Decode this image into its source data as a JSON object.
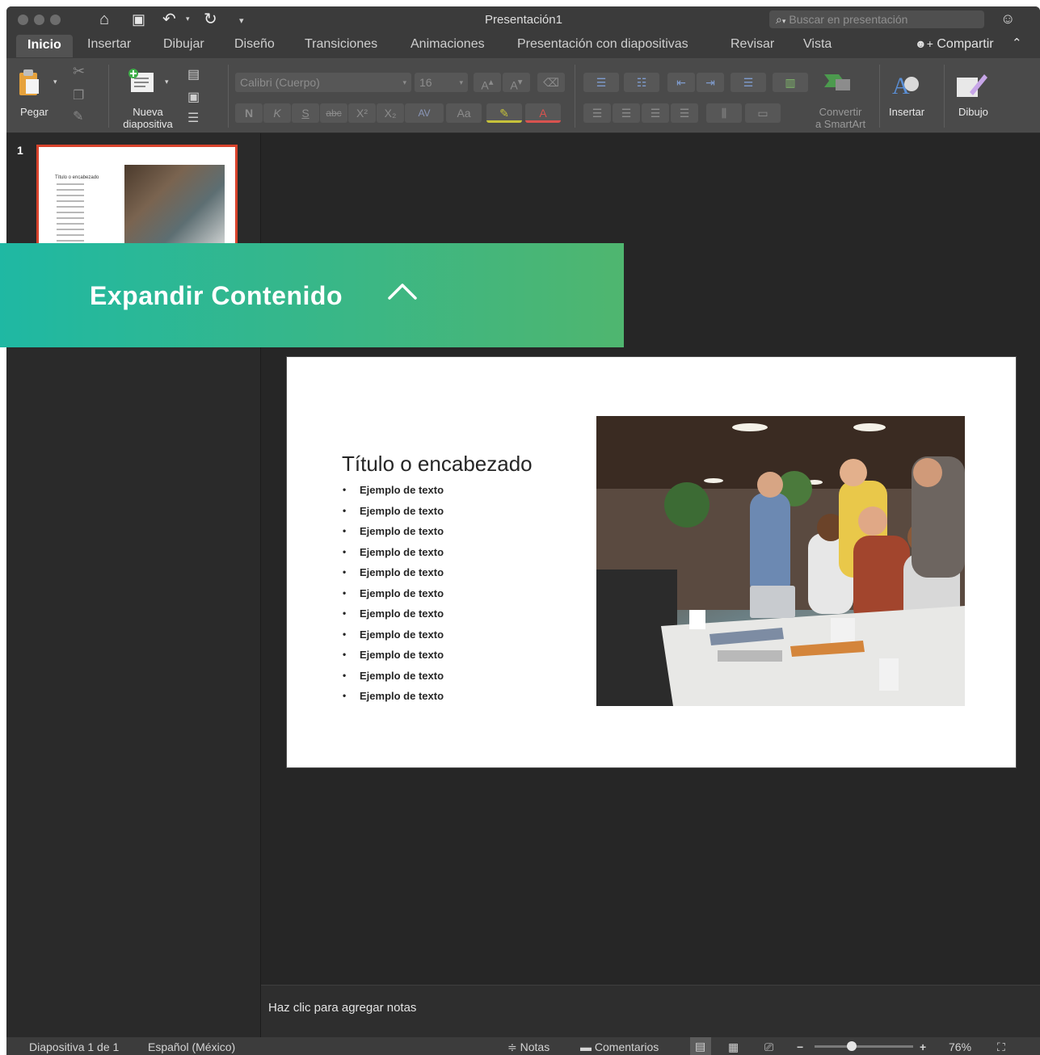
{
  "window": {
    "title": "Presentación1",
    "search_placeholder": "Buscar en presentación",
    "search_icon": "⌕",
    "account_icon": "☺"
  },
  "quick_access": {
    "home_icon": "⌂",
    "save_icon": "▣",
    "undo_icon": "↶",
    "redo_icon": "↻",
    "customize_icon": "▾"
  },
  "tabs": [
    "Inicio",
    "Insertar",
    "Dibujar",
    "Diseño",
    "Transiciones",
    "Animaciones",
    "Presentación con diapositivas",
    "Revisar",
    "Vista"
  ],
  "share": {
    "label": "Compartir",
    "icon": "☺"
  },
  "ribbon": {
    "paste_label": "Pegar",
    "new_slide_label_1": "Nueva",
    "new_slide_label_2": "diapositiva",
    "font_family": "Calibri (Cuerpo)",
    "font_size": "16",
    "grow_font": "A",
    "shrink_font": "A",
    "bold": "N",
    "italic": "K",
    "underline": "S",
    "strike": "abc",
    "superscript": "X²",
    "subscript": "X₂",
    "spacing": "AV",
    "case": "Aa",
    "highlight": "✎",
    "font_color": "A",
    "convert_label_1": "Convertir",
    "convert_label_2": "a SmartArt",
    "insert_label": "Insertar",
    "draw_label": "Dibujo"
  },
  "thumbnails": {
    "slide_number": "1",
    "mini_title": "Título o encabezado"
  },
  "slide": {
    "title": "Título o encabezado",
    "bullets": [
      "Ejemplo de texto",
      "Ejemplo de texto",
      "Ejemplo de texto",
      "Ejemplo de texto",
      "Ejemplo de texto",
      "Ejemplo de texto",
      "Ejemplo de texto",
      "Ejemplo de texto",
      "Ejemplo de texto",
      "Ejemplo de texto",
      "Ejemplo de texto"
    ]
  },
  "notes": {
    "placeholder": "Haz clic para agregar notas"
  },
  "status": {
    "slide_info": "Diapositiva 1 de 1",
    "language": "Español (México)",
    "notes_label": "Notas",
    "comments_label": "Comentarios",
    "zoom_minus": "−",
    "zoom_plus": "+",
    "zoom_value": "76%",
    "zoom_fraction": 0.38
  },
  "banner": {
    "label": "Expandir Contenido",
    "colors": {
      "start": "#1fb8a3",
      "end": "#4fb66f"
    }
  },
  "colors": {
    "accent_selected_slide": "#d9432c",
    "window_bg": "#262626"
  }
}
